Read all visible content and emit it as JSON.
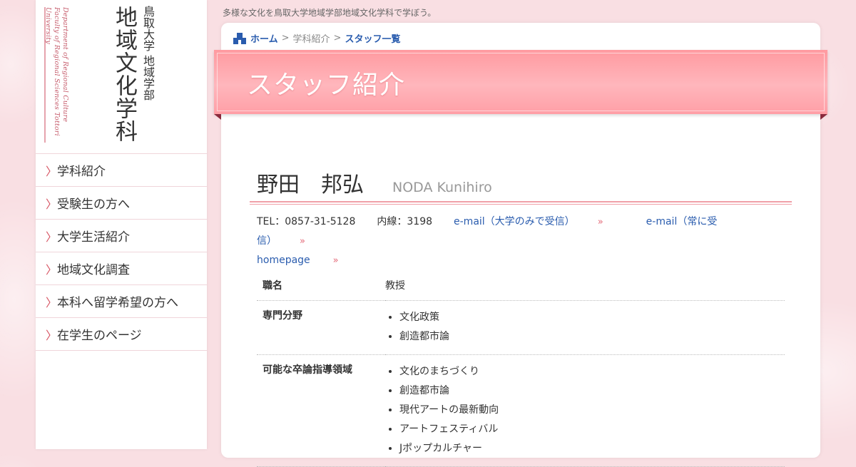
{
  "tagline": "多様な文化を鳥取大学地域学部地域文化学科で学ぼう。",
  "logo": {
    "main": "地域文化学科",
    "sub": "鳥取大学 地域学部",
    "english": "Department of Regional Culture Faculty of Regional Sciences Tottori University"
  },
  "nav": [
    {
      "label": "学科紹介"
    },
    {
      "label": "受験生の方へ"
    },
    {
      "label": "大学生活紹介"
    },
    {
      "label": "地域文化調査"
    },
    {
      "label": "本科へ留学希望の方へ"
    },
    {
      "label": "在学生のページ"
    }
  ],
  "breadcrumb": {
    "home": "ホーム",
    "sep1": ">",
    "middle": "学科紹介",
    "sep2": ">",
    "current": "スタッフ一覧"
  },
  "banner_title": "スタッフ紹介",
  "person": {
    "name_ja": "野田　邦弘",
    "name_en": "NODA Kunihiro",
    "tel": "TEL：0857-31-5128",
    "ext": "内線：3198",
    "email_univ": "e-mail（大学のみで受信）",
    "email_always": "e-mail（常に受信）",
    "homepage": "homepage"
  },
  "info": {
    "position_label": "職名",
    "position_value": "教授",
    "field_label": "専門分野",
    "fields": [
      "文化政策",
      "創造都市論"
    ],
    "thesis_label": "可能な卒論指導領域",
    "thesis": [
      "文化のまちづくり",
      "創造都市論",
      "現代アートの最新動向",
      "アートフェスティバル",
      "Jポップカルチャー"
    ]
  },
  "colors": {
    "accent": "#d6505f",
    "link": "#2a5cae",
    "banner": "#ffa8ae"
  }
}
